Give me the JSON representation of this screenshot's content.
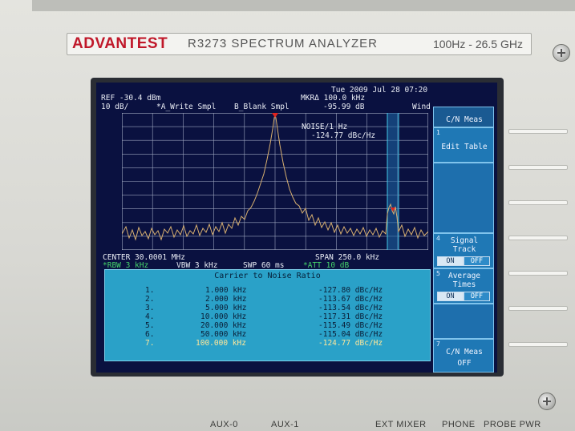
{
  "instrument": {
    "brand": "ADVANTEST",
    "model": "R3273  SPECTRUM  ANALYZER",
    "range": "100Hz - 26.5 GHz"
  },
  "status": {
    "datetime": "Tue 2009 Jul 28 07:20",
    "ref": "REF -30.4 dBm",
    "marker": "MKRΔ 100.0 kHz",
    "scale": "10 dB/",
    "trace_a": "*A_Write Smpl",
    "trace_b": "B_Blank Smpl",
    "marker_level": "-95.99 dB",
    "wind": "Wind"
  },
  "trace_marker": {
    "label": "NOISE/1 Hz",
    "value": "-124.77 dBc/Hz"
  },
  "sweep": {
    "center": "CENTER 30.0001 MHz",
    "span": "SPAN 250.0 kHz",
    "rbw": "*RBW 3 kHz",
    "vbw": "VBW 3 kHz",
    "swp": "SWP 60 ms",
    "att": "*ATT 10 dB"
  },
  "cn_table": {
    "title": "Carrier to Noise Ratio",
    "rows": [
      {
        "index": "1.",
        "offset": "1.000 kHz",
        "value": "-127.80 dBc/Hz"
      },
      {
        "index": "2.",
        "offset": "2.000 kHz",
        "value": "-113.67 dBc/Hz"
      },
      {
        "index": "3.",
        "offset": "5.000 kHz",
        "value": "-113.54 dBc/Hz"
      },
      {
        "index": "4.",
        "offset": "10.000 kHz",
        "value": "-117.31 dBc/Hz"
      },
      {
        "index": "5.",
        "offset": "20.000 kHz",
        "value": "-115.49 dBc/Hz"
      },
      {
        "index": "6.",
        "offset": "50.000 kHz",
        "value": "-115.04 dBc/Hz"
      },
      {
        "index": "7.",
        "offset": "100.000 kHz",
        "value": "-124.77 dBc/Hz"
      }
    ]
  },
  "softkeys": {
    "menu_title": "C/N Meas",
    "key1_num": "1",
    "key1": "Edit Table",
    "key4_num": "4",
    "key4_line1": "Signal",
    "key4_line2": "Track",
    "key4_on": "ON",
    "key4_off": "OFF",
    "key5_num": "5",
    "key5_line1": "Average",
    "key5_line2": "Times",
    "key5_on": "ON",
    "key5_off": "OFF",
    "key7_num": "7",
    "key7_line1": "C/N Meas",
    "key7_line2": "OFF"
  },
  "ports": {
    "aux0": "AUX-0",
    "aux1": "AUX-1",
    "ext_mixer": "EXT MIXER",
    "phone": "PHONE",
    "probe_pwr": "PROBE PWR"
  },
  "colors": {
    "brand_red": "#c0182a",
    "screen_bg": "#0a1140",
    "trace": "#d8b070",
    "marker": "#e0241e",
    "table_bg": "#2aa1c8",
    "highlight_text": "#ffe79a",
    "softkey_bg": "#1f78b5"
  }
}
